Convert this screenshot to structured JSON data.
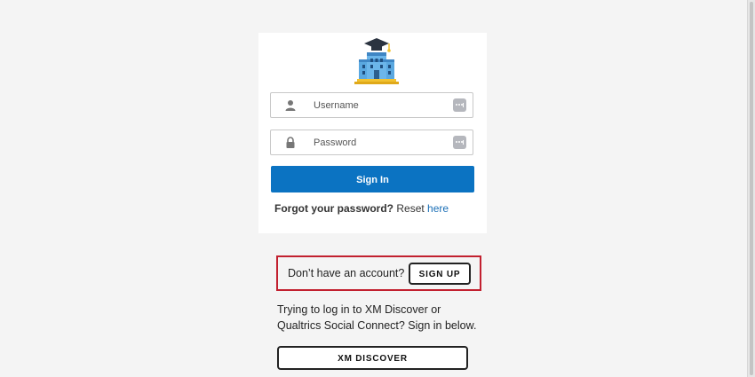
{
  "login": {
    "logo_icon": "university-building-icon",
    "username_placeholder": "Username",
    "password_placeholder": "Password",
    "signin_label": "Sign In",
    "forgot_bold": "Forgot your password?",
    "forgot_reset": " Reset ",
    "forgot_link": "here"
  },
  "signup": {
    "prompt": "Don’t have an account?",
    "button_label": "SIGN UP",
    "highlight_color": "#c2202f"
  },
  "xm": {
    "info_line1": "Trying to log in to XM Discover or",
    "info_line2": "Qualtrics Social Connect? Sign in below.",
    "button_label": "XM DISCOVER"
  },
  "colors": {
    "accent": "#0b73c2",
    "background": "#f4f4f4"
  }
}
